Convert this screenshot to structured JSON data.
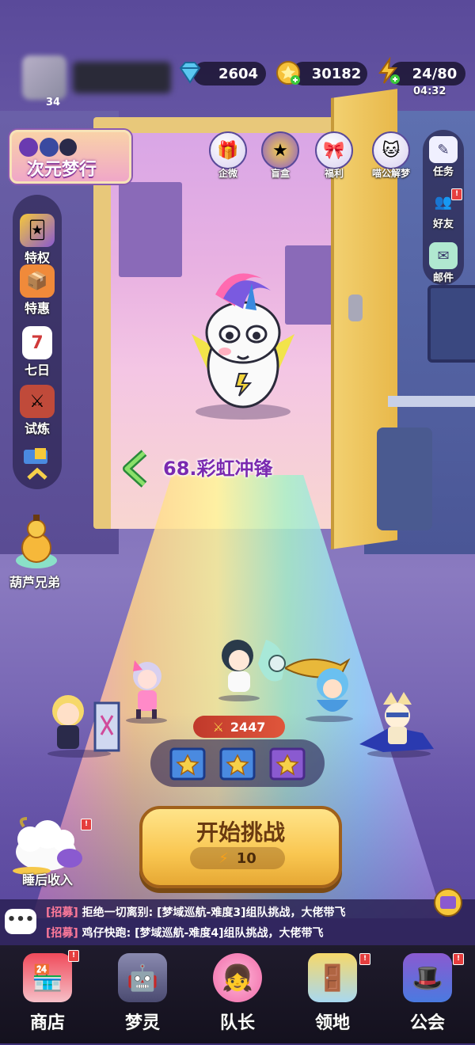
{
  "player": {
    "level": "34"
  },
  "resources": {
    "diamonds": "2604",
    "coins": "30182",
    "energy": "24/80",
    "energy_timer": "04:32"
  },
  "event_banner": {
    "label": "次元梦行"
  },
  "top_menu": [
    {
      "label": "企微",
      "icon": "gift-icon"
    },
    {
      "label": "盲盒",
      "icon": "blind-box-icon"
    },
    {
      "label": "福利",
      "icon": "welfare-icon"
    },
    {
      "label": "喵公解梦",
      "icon": "cat-dream-icon"
    }
  ],
  "right_menu": [
    {
      "label": "任务",
      "icon": "task-icon"
    },
    {
      "label": "好友",
      "icon": "friends-icon"
    },
    {
      "label": "邮件",
      "icon": "mail-icon"
    }
  ],
  "left_menu": [
    {
      "label": "特权",
      "icon": "privilege-icon"
    },
    {
      "label": "特惠",
      "icon": "discount-icon"
    },
    {
      "label": "七日",
      "icon": "seven-day-icon"
    },
    {
      "label": "试炼",
      "icon": "trial-icon"
    }
  ],
  "gourd": {
    "label": "葫芦兄弟"
  },
  "stage": {
    "title": "68.彩虹冲锋"
  },
  "team": {
    "power": "2447"
  },
  "start": {
    "label": "开始挑战",
    "cost": "10"
  },
  "sleep_income": {
    "label": "睡后收入"
  },
  "chat": [
    {
      "tag": "[招募]",
      "text": "拒绝一切离别: [梦域巡航-难度3]组队挑战，大佬带飞"
    },
    {
      "tag": "[招募]",
      "text": "鸡仔快跑: [梦域巡航-难度4]组队挑战，大佬带飞"
    }
  ],
  "bottom_nav": [
    {
      "label": "商店",
      "icon": "shop-icon"
    },
    {
      "label": "梦灵",
      "icon": "dream-spirit-icon"
    },
    {
      "label": "队长",
      "icon": "captain-icon"
    },
    {
      "label": "领地",
      "icon": "territory-icon"
    },
    {
      "label": "公会",
      "icon": "guild-icon"
    }
  ],
  "colors": {
    "accent": "#f9c650",
    "stage_title": "#7a2ab0",
    "power_bar": "#d94a34"
  }
}
